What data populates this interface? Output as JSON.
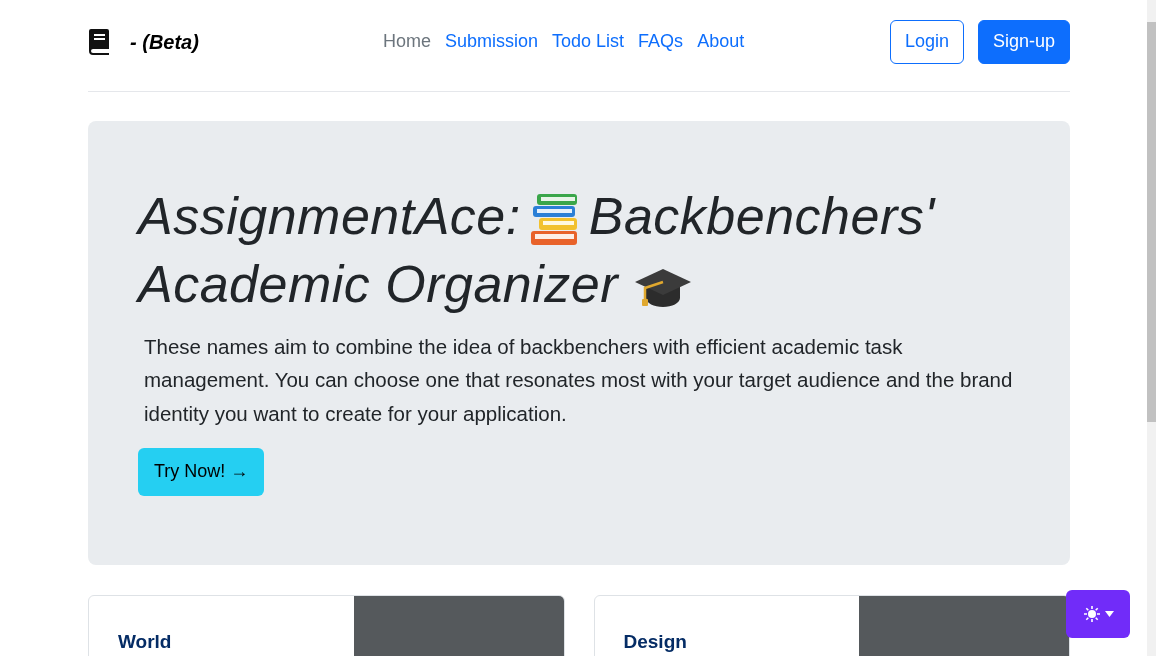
{
  "brand": {
    "text": "- (Beta)"
  },
  "nav": [
    {
      "label": "Home",
      "kind": "muted"
    },
    {
      "label": "Submission",
      "kind": "link"
    },
    {
      "label": "Todo List",
      "kind": "link"
    },
    {
      "label": "FAQs",
      "kind": "link"
    },
    {
      "label": "About",
      "kind": "link"
    }
  ],
  "auth_buttons": [
    {
      "label": "Login",
      "kind": "outline"
    },
    {
      "label": "Sign-up",
      "kind": "solid"
    }
  ],
  "hero": {
    "title_start": "AssignmentAce:",
    "title_middle": "Backbenchers' Academic Organizer",
    "text": "These names aim to combine the idea of backbenchers with efficient academic task management. You can choose one that resonates most with your target audience and the brand identity you want to create for your application.",
    "button": "Try Now! →"
  },
  "cards": [
    {
      "title": "World"
    },
    {
      "title": "Design"
    }
  ]
}
